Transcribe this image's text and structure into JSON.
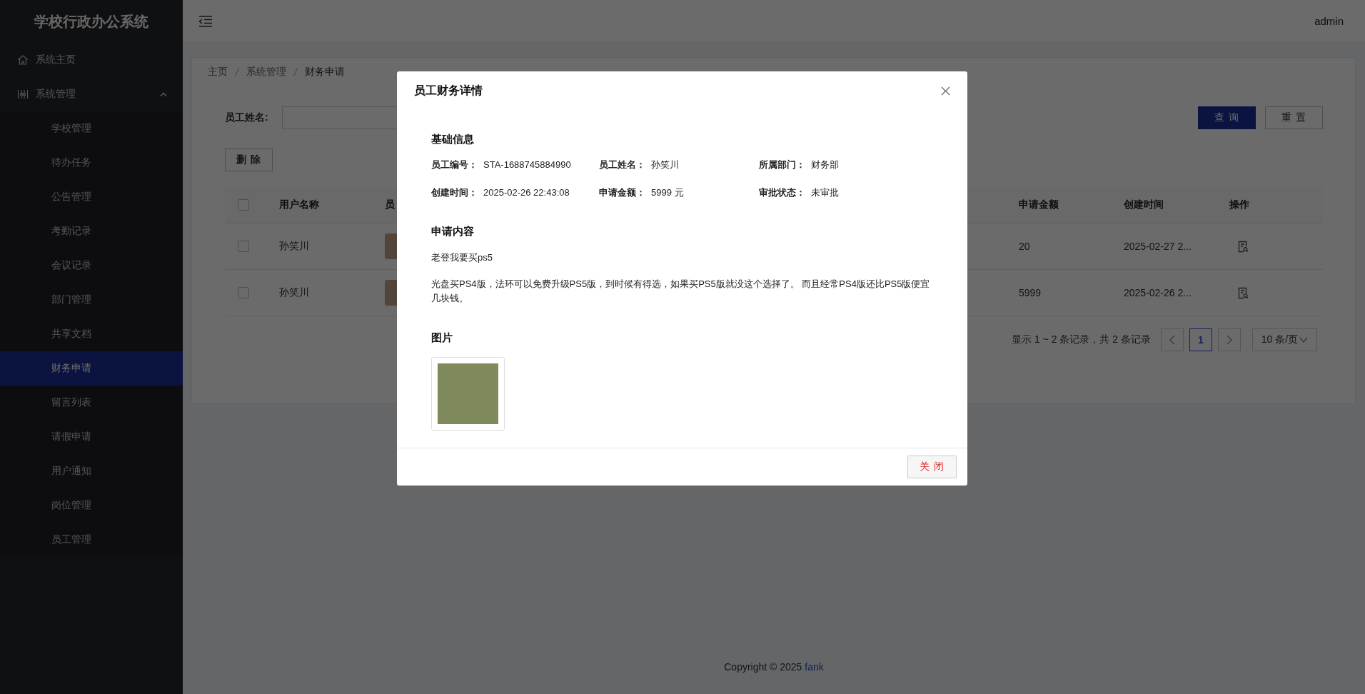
{
  "sidebar": {
    "title": "学校行政办公系统",
    "items": [
      {
        "kind": "link",
        "label": "系统主页"
      },
      {
        "kind": "group",
        "label": "系统管理",
        "expanded": true,
        "children": [
          {
            "label": "学校管理",
            "selected": false
          },
          {
            "label": "待办任务",
            "selected": false
          },
          {
            "label": "公告管理",
            "selected": false
          },
          {
            "label": "考勤记录",
            "selected": false
          },
          {
            "label": "会议记录",
            "selected": false
          },
          {
            "label": "部门管理",
            "selected": false
          },
          {
            "label": "共享文档",
            "selected": false
          },
          {
            "label": "财务申请",
            "selected": true
          },
          {
            "label": "留言列表",
            "selected": false
          },
          {
            "label": "请假申请",
            "selected": false
          },
          {
            "label": "用户通知",
            "selected": false
          },
          {
            "label": "岗位管理",
            "selected": false
          },
          {
            "label": "员工管理",
            "selected": false
          }
        ]
      }
    ]
  },
  "header": {
    "user": "admin"
  },
  "breadcrumb": [
    "主页",
    "系统管理",
    "财务申请"
  ],
  "filter": {
    "label": "员工姓名:"
  },
  "buttons": {
    "query": "查 询",
    "reset": "重 置",
    "delete": "删 除"
  },
  "table": {
    "header_checked": false,
    "columns": [
      "用户名称",
      "员",
      "申请金额",
      "创建时间",
      "操作"
    ],
    "rows": [
      {
        "checked": false,
        "user": "孙笑川",
        "amount": "20",
        "created": "2025-02-27 2..."
      },
      {
        "checked": false,
        "user": "孙笑川",
        "amount": "5999",
        "created": "2025-02-26 2..."
      }
    ]
  },
  "pagination": {
    "summary": "显示 1 ~ 2 条记录，共 2 条记录",
    "pages": [
      {
        "label": "1",
        "selected": true
      }
    ],
    "page_size": "10 条/页"
  },
  "footer": {
    "text": "Copyright © 2025",
    "link": "fank"
  },
  "dialog": {
    "title": "员工财务详情",
    "sections": [
      {
        "kind": "fields",
        "title": "基础信息",
        "fields": [
          {
            "label": "员工编号：",
            "value": "STA-1688745884990"
          },
          {
            "label": "员工姓名：",
            "value": "孙笑川"
          },
          {
            "label": "所属部门：",
            "value": "财务部"
          },
          {
            "label": "创建时间：",
            "value": "2025-02-26 22:43:08"
          },
          {
            "label": "申请金额：",
            "value": "5999 元"
          },
          {
            "label": "审批状态：",
            "value": "未审批"
          }
        ]
      },
      {
        "kind": "text",
        "title": "申请内容",
        "paragraphs": [
          "老登我要买ps5",
          "光盘买PS4版，法环可以免费升级PS5版，到时候有得选，如果买PS5版就没这个选择了。 而且经常PS4版还比PS5版便宜几块钱。"
        ]
      },
      {
        "kind": "images",
        "title": "图片"
      }
    ],
    "close": "关 闭"
  }
}
